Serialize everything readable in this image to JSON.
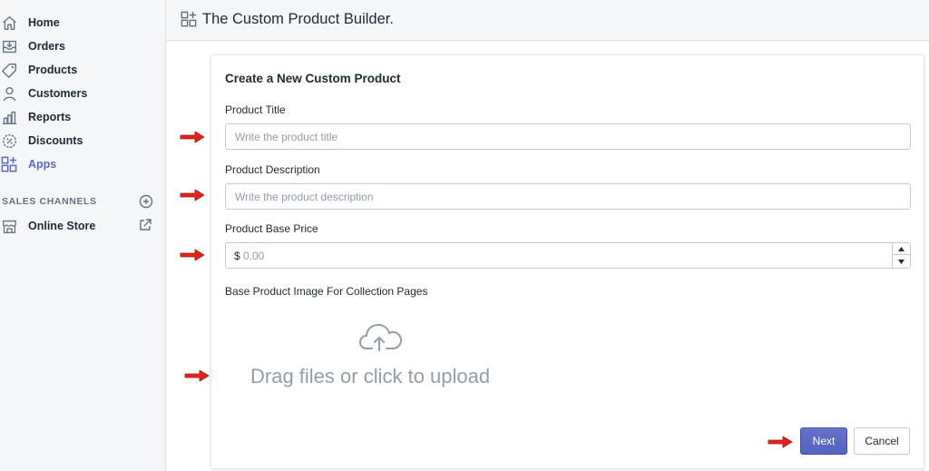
{
  "sidebar": {
    "items": [
      {
        "label": "Home",
        "icon": "home-icon"
      },
      {
        "label": "Orders",
        "icon": "orders-icon"
      },
      {
        "label": "Products",
        "icon": "tag-icon"
      },
      {
        "label": "Customers",
        "icon": "person-icon"
      },
      {
        "label": "Reports",
        "icon": "bar-chart-icon"
      },
      {
        "label": "Discounts",
        "icon": "discount-icon"
      },
      {
        "label": "Apps",
        "icon": "apps-icon",
        "active": true
      }
    ],
    "section_label": "SALES CHANNELS",
    "channels": [
      {
        "label": "Online Store",
        "icon": "store-icon"
      }
    ]
  },
  "header": {
    "title": "The Custom Product Builder."
  },
  "form": {
    "card_title": "Create a New Custom Product",
    "title_label": "Product Title",
    "title_placeholder": "Write the product title",
    "description_label": "Product Description",
    "description_placeholder": "Write the product description",
    "price_label": "Product Base Price",
    "price_prefix": "$",
    "price_placeholder": "0.00",
    "image_label": "Base Product Image For Collection Pages",
    "dropzone_text": "Drag files or click to upload",
    "next_label": "Next",
    "cancel_label": "Cancel"
  },
  "colors": {
    "accent": "#5c6ac4",
    "annotation_arrow": "#e0261b"
  }
}
